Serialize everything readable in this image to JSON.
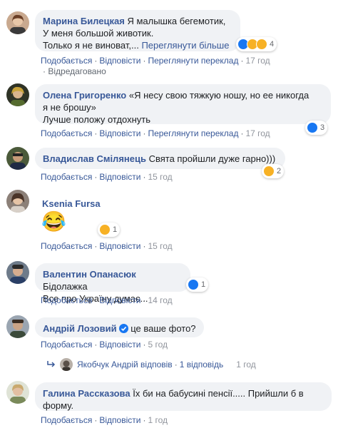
{
  "actions": {
    "like": "Подобається",
    "reply": "Відповісти",
    "see_translation": "Переглянути переклад",
    "dot": "·"
  },
  "comments": [
    {
      "author": "Марина Билецкая",
      "text1": "Я малышка бегемотик,",
      "text2": "У меня большой животик.",
      "text3": "Только я не виноват,...",
      "see_more": "Переглянути більше",
      "reactions_count": "4",
      "time": "17 год",
      "edited": "Відредаговано"
    },
    {
      "author": "Олена Григоренко",
      "text1": "«Я несу свою тяжкую ношу, но ее никогда",
      "text2": "я не брошу»",
      "text3": "Лучше положу отдохнуть",
      "reactions_count": "3",
      "time": "17 год"
    },
    {
      "author": "Владислав Смілянець",
      "text1": "Свята пройшли дуже гарно)))",
      "reactions_count": "2",
      "time": "15 год"
    },
    {
      "author": "Ksenia Fursa",
      "emoji": "😂",
      "reactions_count": "1",
      "time": "15 год"
    },
    {
      "author": "Валентин Опанасюк",
      "text1": "Бідолажка",
      "text2": "Все про Україну думає...",
      "reactions_count": "1",
      "time": "14 год"
    },
    {
      "author": "Андрій Лозовий",
      "text1": "це ваше фото?",
      "time": "5 год",
      "reply_author": "Якобчук Андрій відповів",
      "reply_count": "1 відповідь",
      "reply_time": "1 год"
    },
    {
      "author": "Галина Рассказова",
      "text1": "Їх би на бабусині пенсії..... Прийшли б в",
      "text2": "форму.",
      "time": "1 год"
    }
  ],
  "colors": {
    "link": "#385898",
    "bubble": "#f0f2f5",
    "like": "#1877f2",
    "emoji": "#f7b125"
  }
}
